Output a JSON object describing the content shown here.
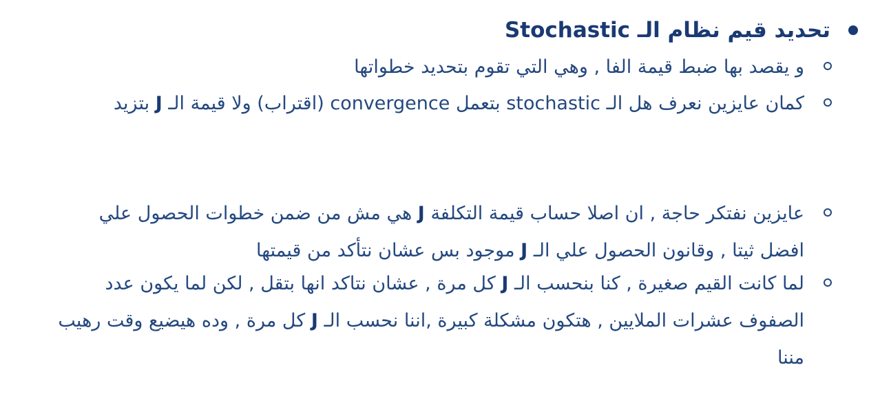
{
  "heading": {
    "text": "تحديد قيم نظام الـ Stochastic"
  },
  "items": [
    {
      "text": "و يقصد بها ضبط قيمة الفا , وهي التي تقوم بتحديد خطواتها"
    },
    {
      "part1": "كمان عايزين نعرف هل الـ",
      "term1": "stochastic",
      "part2": "بتعمل",
      "term2": "convergence",
      "part3": "(اقتراب) ولا قيمة الـ",
      "term3": "J",
      "part4": "بتزيد"
    },
    {
      "part1": "عايزين نفتكر حاجة , ان اصلا حساب قيمة التكلفة",
      "term1": "J",
      "part2": "هي مش من ضمن خطوات الحصول علي افضل ثيتا , وقانون الحصول علي الـ",
      "term2": "J",
      "part3": "موجود بس عشان نتأكد من قيمتها"
    },
    {
      "part1": "لما كانت القيم صغيرة , كنا بنحسب الـ",
      "term1": "J",
      "part2": "كل مرة , عشان نتاكد انها بتقل , لكن لما يكون عدد الصفوف عشرات الملايين , هتكون مشكلة كبيرة ,اننا نحسب الـ",
      "term2": "J",
      "part3": "كل مرة , وده هيضيع وقت رهيب مننا"
    }
  ]
}
